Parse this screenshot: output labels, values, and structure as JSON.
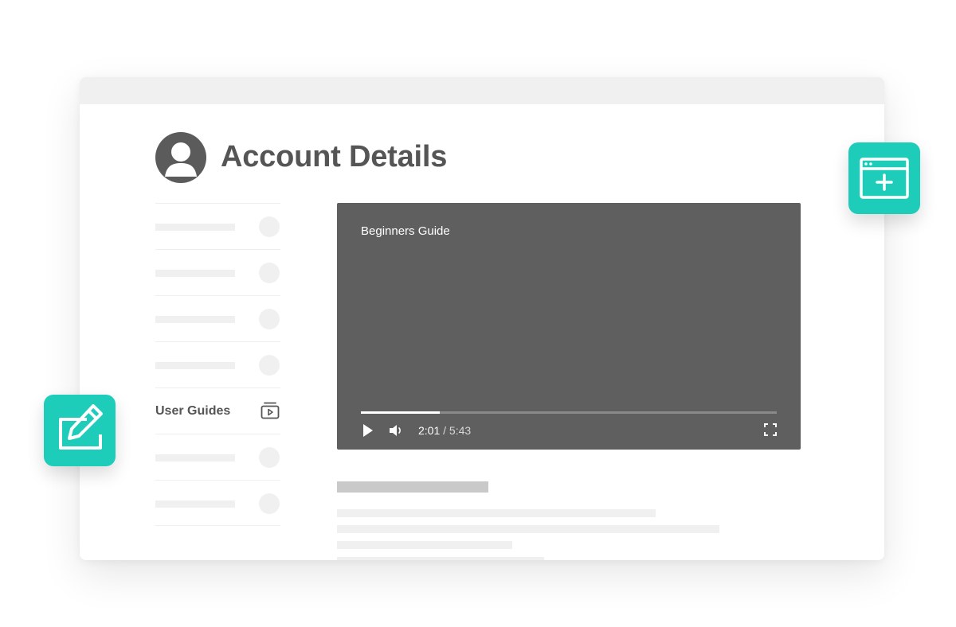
{
  "header": {
    "title": "Account Details",
    "avatar_icon": "user-avatar-icon"
  },
  "sidebar": {
    "items": [
      {
        "label": "",
        "placeholder": true
      },
      {
        "label": "",
        "placeholder": true
      },
      {
        "label": "",
        "placeholder": true
      },
      {
        "label": "",
        "placeholder": true
      },
      {
        "label": "User Guides",
        "icon": "video-playlist-icon",
        "active": true
      },
      {
        "label": "",
        "placeholder": true
      },
      {
        "label": "",
        "placeholder": true
      }
    ]
  },
  "player": {
    "title": "Beginners Guide",
    "current_time": "2:01",
    "separator": " / ",
    "duration": "5:43",
    "progress": 0.19,
    "controls": [
      "play-icon",
      "volume-icon",
      "fullscreen-icon"
    ]
  },
  "floating_buttons": {
    "edit_icon": "edit-icon",
    "add_window_icon": "add-window-icon"
  },
  "colors": {
    "accent": "#1ecdb9",
    "player_bg": "#5f5f5f",
    "text_dark": "#555555",
    "placeholder": "#f0f0f0"
  }
}
